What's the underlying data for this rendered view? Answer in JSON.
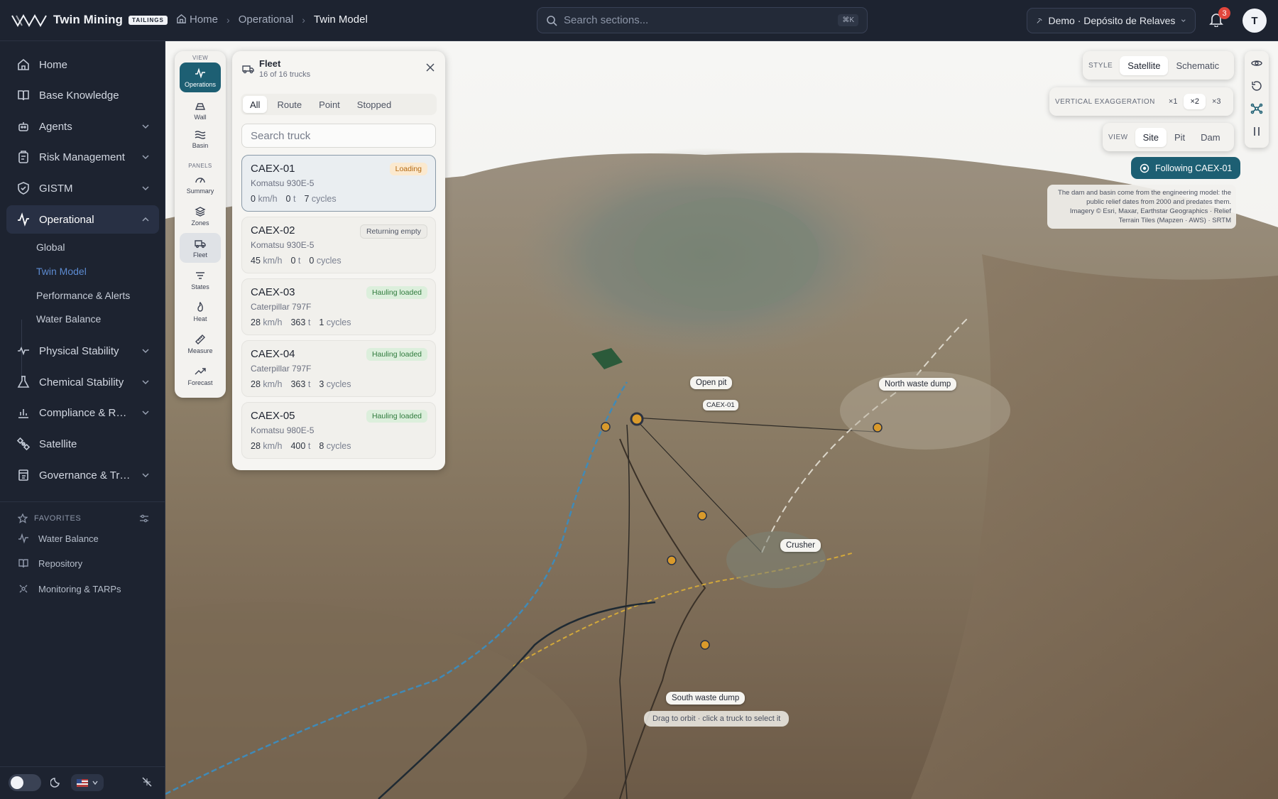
{
  "app": {
    "brand": "Twin Mining",
    "badge": "TAILINGS"
  },
  "breadcrumb": [
    "Home",
    "Operational",
    "Twin Model"
  ],
  "search": {
    "placeholder": "Search sections...",
    "shortcut": "⌘K"
  },
  "site_select": {
    "label": "Demo · Depósito de Relaves"
  },
  "notifications": {
    "count": "3"
  },
  "user": {
    "initial": "T"
  },
  "sidebar": {
    "items": [
      {
        "label": "Home",
        "icon": "home-icon"
      },
      {
        "label": "Base Knowledge",
        "icon": "book-icon"
      },
      {
        "label": "Agents",
        "icon": "bot-icon"
      },
      {
        "label": "Risk Management",
        "icon": "clipboard-icon"
      },
      {
        "label": "GISTM",
        "icon": "shield-check-icon"
      },
      {
        "label": "Operational",
        "icon": "activity-icon"
      },
      {
        "label": "Physical Stability",
        "icon": "pulse-icon"
      },
      {
        "label": "Chemical Stability",
        "icon": "flask-icon"
      },
      {
        "label": "Compliance & Reports",
        "icon": "bar-chart-icon"
      },
      {
        "label": "Satellite",
        "icon": "satellite-icon"
      },
      {
        "label": "Governance & Trace...",
        "icon": "ledger-icon"
      }
    ],
    "operational_sub": [
      "Global",
      "Twin Model",
      "Performance & Alerts",
      "Water Balance"
    ],
    "favorites_title": "FAVORITES",
    "favorites": [
      "Water Balance",
      "Repository",
      "Monitoring & TARPs"
    ]
  },
  "rail": {
    "view_label": "VIEW",
    "panels_label": "PANELS",
    "view_buttons": [
      "Operations",
      "Wall",
      "Basin"
    ],
    "panel_buttons": [
      "Summary",
      "Zones",
      "Fleet",
      "States",
      "Heat",
      "Measure",
      "Forecast"
    ]
  },
  "fleet": {
    "title": "Fleet",
    "subtitle": "16 of 16 trucks",
    "tabs": [
      "All",
      "Route",
      "Point",
      "Stopped"
    ],
    "search_placeholder": "Search truck",
    "trucks": [
      {
        "id": "CAEX-01",
        "model": "Komatsu 930E-5",
        "status": "Loading",
        "speed": "0",
        "load": "0",
        "cycles": "7"
      },
      {
        "id": "CAEX-02",
        "model": "Komatsu 930E-5",
        "status": "Returning empty",
        "speed": "45",
        "load": "0",
        "cycles": "0"
      },
      {
        "id": "CAEX-03",
        "model": "Caterpillar 797F",
        "status": "Hauling loaded",
        "speed": "28",
        "load": "363",
        "cycles": "1"
      },
      {
        "id": "CAEX-04",
        "model": "Caterpillar 797F",
        "status": "Hauling loaded",
        "speed": "28",
        "load": "363",
        "cycles": "3"
      },
      {
        "id": "CAEX-05",
        "model": "Komatsu 980E-5",
        "status": "Hauling loaded",
        "speed": "28",
        "load": "400",
        "cycles": "8"
      }
    ],
    "units": {
      "speed": "km/h",
      "load": "t",
      "cycles": "cycles"
    }
  },
  "controls": {
    "style_label": "STYLE",
    "style_options": [
      "Satellite",
      "Schematic"
    ],
    "vexag_label": "VERTICAL EXAGGERATION",
    "vexag_options": [
      "×1",
      "×2",
      "×3"
    ],
    "view_label": "VIEW",
    "view_options": [
      "Site",
      "Pit",
      "Dam"
    ],
    "following": "Following CAEX-01",
    "attribution": {
      "note": "The dam and basin come from the engineering model: the public relief dates from 2000 and predates them.",
      "imagery": "Imagery © Esri, Maxar, Earthstar Geographics · Relief",
      "terrain": "Terrain Tiles (Mapzen · AWS) · SRTM"
    }
  },
  "map_labels": {
    "open_pit": "Open pit",
    "caex": "CAEX-01",
    "north_dump": "North waste dump",
    "crusher": "Crusher",
    "south_dump": "South waste dump",
    "hint": "Drag to orbit · click a truck to select it"
  },
  "colors": {
    "accent": "#1d5f73",
    "active_link": "#5d8bd1",
    "loading": "#b56a12",
    "hauling": "#2f7a3c",
    "alert": "#e2463c"
  }
}
